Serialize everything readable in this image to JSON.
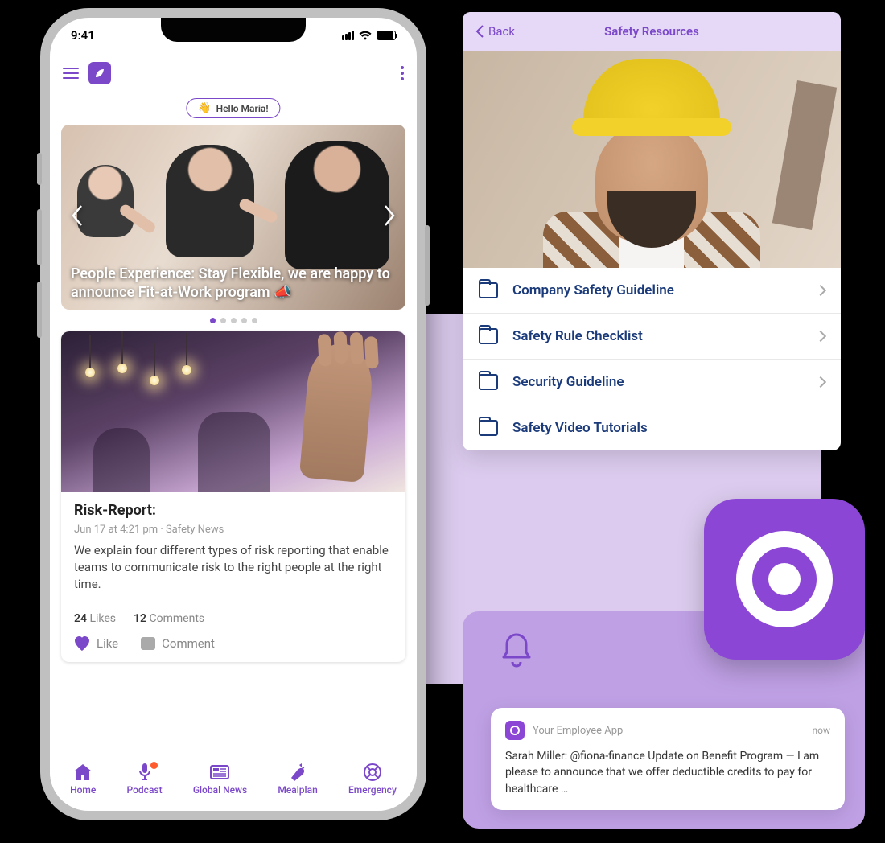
{
  "status_bar": {
    "time": "9:41"
  },
  "greeting": "Hello Maria!",
  "hero": {
    "headline": "People Experience: Stay Flexible, we are happy to announce Fit-at-Work program 📣"
  },
  "carousel": {
    "total": 5,
    "active": 0
  },
  "post": {
    "title": "Risk-Report:",
    "meta": "Jun 17 at  4:21 pm · Safety News",
    "text": "We explain four different types of risk reporting that enable teams to communicate risk to the right people at the right time.",
    "likes_count": "24",
    "likes_label": "Likes",
    "comments_count": "12",
    "comments_label": "Comments",
    "like_action": "Like",
    "comment_action": "Comment"
  },
  "tabs": [
    {
      "label": "Home"
    },
    {
      "label": "Podcast"
    },
    {
      "label": "Global News"
    },
    {
      "label": "Mealplan"
    },
    {
      "label": "Emergency"
    }
  ],
  "safety_panel": {
    "back": "Back",
    "title": "Safety Resources",
    "items": [
      {
        "label": "Company Safety Guideline"
      },
      {
        "label": "Safety Rule Checklist"
      },
      {
        "label": "Security Guideline"
      },
      {
        "label": "Safety Video Tutorials"
      }
    ]
  },
  "notification": {
    "app_name": "Your Employee App",
    "time": "now",
    "body": "Sarah Miller:  @fiona-finance Update on Benefit Program — I am please to announce that we  offer deductible credits to pay for healthcare …"
  },
  "colors": {
    "accent": "#7b48c9"
  }
}
